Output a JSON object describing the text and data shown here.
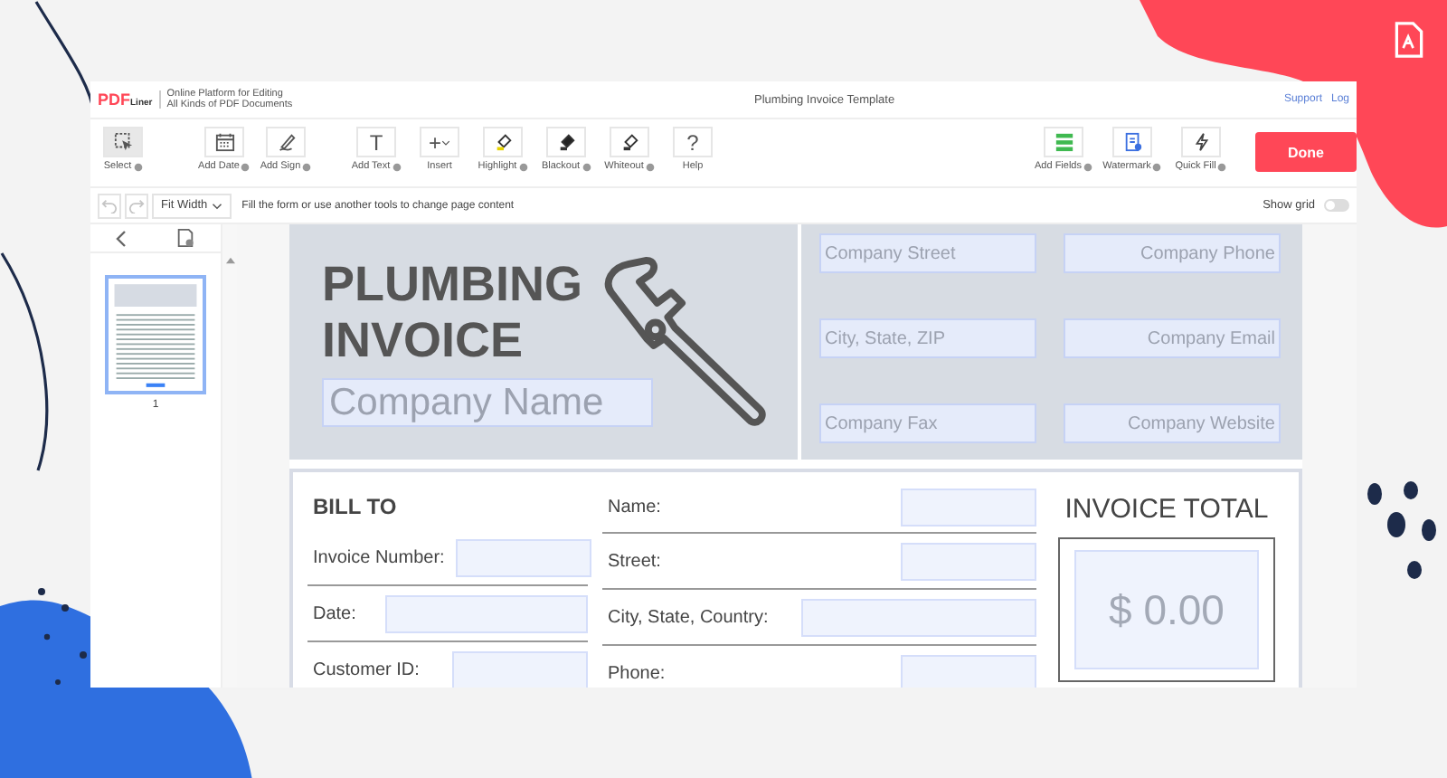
{
  "header": {
    "logo": {
      "brand": "PDF",
      "sub": "Liner"
    },
    "tagline": [
      "Online Platform for Editing",
      "All Kinds of PDF Documents"
    ],
    "title": "Plumbing Invoice Template",
    "links": [
      "Support",
      "Log"
    ]
  },
  "toolbar": {
    "groups": [
      [
        {
          "label": "Select",
          "kind": "select",
          "info": true,
          "selected": true
        }
      ],
      [
        {
          "label": "Add Date",
          "kind": "calendar",
          "info": true,
          "selected": false
        },
        {
          "label": "Add Sign",
          "kind": "sign",
          "info": true,
          "selected": false
        }
      ],
      [
        {
          "label": "Add Text",
          "kind": "glyph",
          "glyph": "T",
          "info": true,
          "selected": false
        },
        {
          "label": "Insert",
          "kind": "glyph",
          "glyph": "+",
          "caret": true,
          "info": false,
          "selected": false
        },
        {
          "label": "Highlight",
          "kind": "highlight",
          "info": true,
          "selected": false
        },
        {
          "label": "Blackout",
          "kind": "blackout",
          "info": true,
          "selected": false
        },
        {
          "label": "Whiteout",
          "kind": "whiteout",
          "info": true,
          "selected": false
        },
        {
          "label": "Help",
          "kind": "glyph",
          "glyph": "?",
          "info": false,
          "selected": false
        }
      ]
    ],
    "right_tools": [
      {
        "label": "Add Fields",
        "kind": "fields",
        "info": true,
        "selected": false
      },
      {
        "label": "Watermark",
        "kind": "watermark",
        "info": true,
        "selected": false
      },
      {
        "label": "Quick Fill",
        "kind": "bolt",
        "info": true,
        "selected": false
      }
    ],
    "done": "Done"
  },
  "subbar": {
    "undo_disabled": true,
    "redo_disabled": true,
    "zoom": "Fit Width",
    "hint": "Fill the form or use another tools to change page content",
    "show_grid": {
      "label": "Show grid",
      "on": false
    }
  },
  "sidebar": {
    "pages": [
      {
        "number": "1",
        "selected": true
      }
    ]
  },
  "document": {
    "title": [
      "PLUMBING",
      "INVOICE"
    ],
    "company_name": {
      "placeholder": "Company Name"
    },
    "company_fields": [
      {
        "placeholder": "Company Street"
      },
      {
        "placeholder": "Company Phone"
      },
      {
        "placeholder": "City, State, ZIP"
      },
      {
        "placeholder": "Company Email"
      },
      {
        "placeholder": "Company Fax"
      },
      {
        "placeholder": "Company Website"
      }
    ],
    "bill_to": {
      "heading": "BILL TO",
      "left_fields": [
        {
          "label": "Invoice Number:"
        },
        {
          "label": "Date:"
        },
        {
          "label": "Customer ID:"
        }
      ],
      "right_fields": [
        {
          "label": "Name:"
        },
        {
          "label": "Street:"
        },
        {
          "label": "City, State, Country:"
        },
        {
          "label": "Phone:"
        }
      ]
    },
    "invoice_total": {
      "label": "INVOICE TOTAL",
      "placeholder": "$ 0.00"
    }
  }
}
